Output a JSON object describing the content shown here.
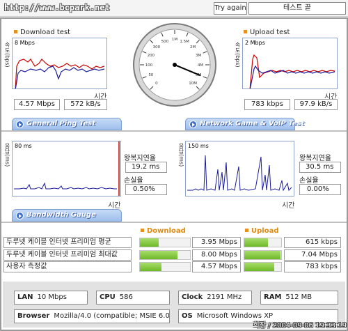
{
  "header": {
    "url": "http://www.bcpark.net",
    "try_again": "Try again",
    "end_test": "테스트 끝"
  },
  "download": {
    "title": "Download test",
    "scale": "8 Mbps",
    "axis": "속도(bps)",
    "time": "시간",
    "mbps": "4.57 Mbps",
    "kbs": "572 kB/s"
  },
  "upload": {
    "title": "Upload test",
    "scale": "2 Mbps",
    "axis": "속도(bps)",
    "time": "시간",
    "kbps": "783 kbps",
    "kbs": "97.9 kB/s"
  },
  "gauge": {
    "ticks": [
      "0",
      "50",
      "100",
      "200",
      "300",
      "500",
      "1M",
      "1.5M",
      "2M",
      "3M",
      "4M",
      "5M",
      "10M"
    ],
    "needle_value": "5M"
  },
  "tabs": {
    "ping": "General Ping Test",
    "game": "Network Game & VoIP Test",
    "bandwidth": "Bandwidth Gauge"
  },
  "ping_general": {
    "scale": "80 ms",
    "axis": "응답(ms)",
    "time": "시간",
    "latency_label": "왕복지연율",
    "latency": "19.2 ms",
    "loss_label": "손실율",
    "loss": "0.50%"
  },
  "ping_game": {
    "scale": "150 ms",
    "axis": "응답(ms)",
    "time": "시간",
    "latency_label": "왕복지연율",
    "latency": "30.5 ms",
    "loss_label": "손실율",
    "loss": "0.00%"
  },
  "bandwidth": {
    "download_head": "Download",
    "upload_head": "Upload",
    "rows": [
      {
        "name": "두루넷 케이블 인터넷 프리미엄 평균",
        "down": "3.95 Mbps",
        "down_pct": 0.37,
        "up": "615 kbps",
        "up_pct": 0.64
      },
      {
        "name": "두루넷 케이블 인터넷 프리미엄 최대값",
        "down": "8.00 Mbps",
        "down_pct": 0.75,
        "up": "7.04 Mbps",
        "up_pct": 0.98
      },
      {
        "name": "사용자 측정값",
        "down": "4.57 Mbps",
        "down_pct": 0.43,
        "up": "783 kbps",
        "up_pct": 0.82
      }
    ]
  },
  "system": {
    "lan_label": "LAN",
    "lan": "10 Mbps",
    "cpu_label": "CPU",
    "cpu": "586",
    "clock_label": "Clock",
    "clock": "2191 MHz",
    "ram_label": "RAM",
    "ram": "512 MB",
    "browser_label": "Browser",
    "browser": "Mozilla/4.0 (compatible; MSIE 6.0",
    "os_label": "OS",
    "os": "Microsoft Windows XP"
  },
  "watermark": "회장 / 2004-09-06 19:33:19",
  "colors": {
    "banner": "#9ebfec",
    "accent": "#e8901c",
    "bar": "#6db828",
    "series_red": "#cc0000",
    "series_blue": "#1a1a9a"
  }
}
